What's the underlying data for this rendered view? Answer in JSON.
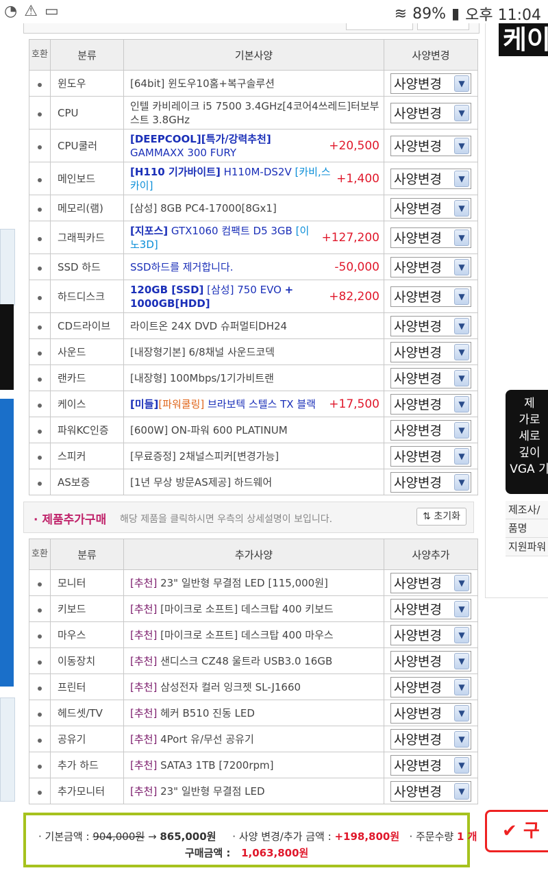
{
  "status_bar": {
    "battery": "89%",
    "time": "오후 11:04"
  },
  "right_panel": {
    "banner": "케이",
    "promo_lines": [
      "제",
      "가로",
      "세로",
      "깊이",
      "VGA 기"
    ],
    "info_rows": [
      "제조사/",
      "품명",
      "지원파워"
    ],
    "buy_label": "구"
  },
  "base_table": {
    "headers": {
      "no": "호환",
      "category": "분류",
      "spec": "기본사양",
      "action": "사양변경"
    },
    "select_label": "사양변경",
    "rows": [
      {
        "category": "윈도우",
        "spec": [
          {
            "t": "[64bit] 윈도우10홈+복구솔루션",
            "c": ""
          }
        ],
        "price": ""
      },
      {
        "category": "CPU",
        "spec": [
          {
            "t": "인텔 카비레이크 i5 7500 3.4GHz[4코어4쓰레드]터보부스트 3.8GHz",
            "c": ""
          }
        ],
        "price": ""
      },
      {
        "category": "CPU쿨러",
        "spec": [
          {
            "t": "[DEEPCOOL]",
            "c": "navy"
          },
          {
            "t": "[특가/강력추천]",
            "c": "navy"
          },
          {
            "t": " GAMMAXX 300 FURY",
            "c": "navy2"
          }
        ],
        "price": "+20,500"
      },
      {
        "category": "메인보드",
        "spec": [
          {
            "t": "[H110 기가바이트]",
            "c": "navy"
          },
          {
            "t": " H110M-DS2V ",
            "c": "navy2"
          },
          {
            "t": "[카비,스카이]",
            "c": "cyan"
          }
        ],
        "price": "+1,400"
      },
      {
        "category": "메모리(램)",
        "spec": [
          {
            "t": "[삼성] 8GB PC4-17000[8Gx1]",
            "c": ""
          }
        ],
        "price": ""
      },
      {
        "category": "그래픽카드",
        "spec": [
          {
            "t": "[지포스]",
            "c": "navy"
          },
          {
            "t": " GTX1060 컴팩트 D5 3GB ",
            "c": "navy2"
          },
          {
            "t": "[이노3D]",
            "c": "cyan"
          }
        ],
        "price": "+127,200"
      },
      {
        "category": "SSD 하드",
        "spec": [
          {
            "t": "SSD하드를 제거합니다.",
            "c": "navy2"
          }
        ],
        "price": "-50,000"
      },
      {
        "category": "하드디스크",
        "spec": [
          {
            "t": "120GB [SSD]",
            "c": "navy"
          },
          {
            "t": " [삼성] 750 EVO ",
            "c": "navy2"
          },
          {
            "t": "+ 1000GB[HDD]",
            "c": "navy"
          }
        ],
        "price": "+82,200"
      },
      {
        "category": "CD드라이브",
        "spec": [
          {
            "t": "라이트온 24X DVD 슈퍼멀티DH24",
            "c": ""
          }
        ],
        "price": ""
      },
      {
        "category": "사운드",
        "spec": [
          {
            "t": "[내장형기본] 6/8채널 사운드코덱",
            "c": ""
          }
        ],
        "price": ""
      },
      {
        "category": "랜카드",
        "spec": [
          {
            "t": "[내장형] 100Mbps/1기가비트랜",
            "c": ""
          }
        ],
        "price": ""
      },
      {
        "category": "케이스",
        "spec": [
          {
            "t": "[미들]",
            "c": "navy"
          },
          {
            "t": "[파워쿨링]",
            "c": "orange"
          },
          {
            "t": " 브라보텍 스텔스 TX 블랙",
            "c": "navy2"
          }
        ],
        "price": "+17,500"
      },
      {
        "category": "파워KC인증",
        "spec": [
          {
            "t": "[600W] ON-파워 600 PLATINUM",
            "c": ""
          }
        ],
        "price": ""
      },
      {
        "category": "스피커",
        "spec": [
          {
            "t": "[무료증정] 2채널스피커[변경가능]",
            "c": ""
          }
        ],
        "price": ""
      },
      {
        "category": "AS보증",
        "spec": [
          {
            "t": "[1년 무상 방문AS제공] 하드웨어",
            "c": ""
          }
        ],
        "price": ""
      }
    ]
  },
  "add_bar": {
    "title": "· 제품추가구매",
    "desc": "해당 제품을 클릭하시면 우측의 상세설명이 보입니다.",
    "reset_label": "초기화"
  },
  "add_table": {
    "headers": {
      "no": "호환",
      "category": "분류",
      "spec": "추가사양",
      "action": "사양추가"
    },
    "select_label": "사양변경",
    "tag": "[추천]",
    "rows": [
      {
        "category": "모니터",
        "spec": "23\" 일반형 무결점 LED [115,000원]"
      },
      {
        "category": "키보드",
        "spec": "[마이크로 소프트] 데스크탑 400 키보드"
      },
      {
        "category": "마우스",
        "spec": "[마이크로 소프트] 데스크탑 400 마우스"
      },
      {
        "category": "이동장치",
        "spec": "샌디스크 CZ48 울트라 USB3.0 16GB"
      },
      {
        "category": "프린터",
        "spec": "삼성전자 컬러 잉크젯 SL-J1660"
      },
      {
        "category": "헤드셋/TV",
        "spec": "헤커 B510 진동 LED"
      },
      {
        "category": "공유기",
        "spec": "4Port 유/무선 공유기"
      },
      {
        "category": "추가 하드",
        "spec": "SATA3 1TB [7200rpm]"
      },
      {
        "category": "추가모니터",
        "spec": "23\" 일반형 무결점 LED"
      }
    ]
  },
  "summary": {
    "base_label": "· 기본금액 :",
    "base_old": "904,000원",
    "arrow": "→",
    "base_new": "865,000원",
    "change_label": "· 사양 변경/추가 금액 :",
    "change_value": "+198,800원",
    "qty_label": "· 주문수량",
    "qty_value": "1 개",
    "total_label": "구매금액 :",
    "total_value": "1,063,800원"
  }
}
